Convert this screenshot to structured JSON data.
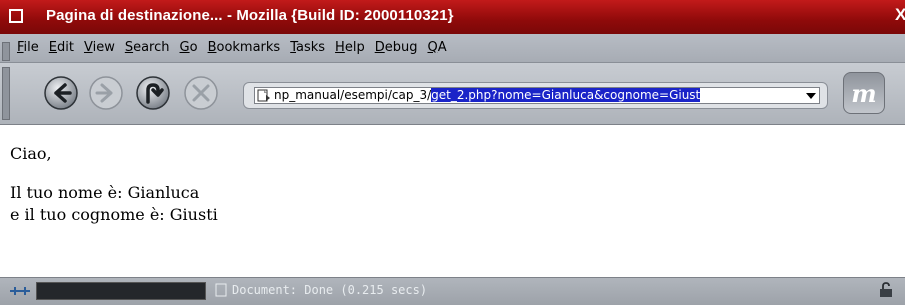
{
  "window": {
    "title": "Pagina di destinazione... - Mozilla {Build ID: 2000110321}",
    "close_glyph": "X"
  },
  "menubar": {
    "items": [
      "File",
      "Edit",
      "View",
      "Search",
      "Go",
      "Bookmarks",
      "Tasks",
      "Help",
      "Debug",
      "QA"
    ]
  },
  "toolbar": {
    "back_icon": "back-arrow-icon",
    "forward_icon": "forward-arrow-icon",
    "reload_icon": "reload-icon",
    "stop_icon": "stop-icon",
    "url_prefix": "np_manual/esempi/cap_3/",
    "url_selected": "get_2.php?nome=Gianluca&cognome=Giust",
    "logo_text": "m"
  },
  "content": {
    "line1": "Ciao,",
    "line2": "Il tuo nome è: Gianluca",
    "line3": "e il tuo cognome è: Giusti"
  },
  "statusbar": {
    "text": "Document: Done (0.215 secs)"
  },
  "colors": {
    "titlebar": "#a01010",
    "selection": "#1a24c8"
  }
}
